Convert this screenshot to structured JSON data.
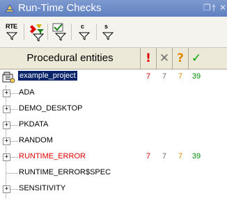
{
  "window": {
    "title": "Run-Time Checks",
    "controls": [
      "❐",
      "†",
      "✕"
    ]
  },
  "toolbar": {
    "rte_label": "RTE",
    "c_label": "c",
    "s_label": "s"
  },
  "table": {
    "header": {
      "entities": "Procedural entities",
      "col1": "!",
      "col2": "✕",
      "col3": "?",
      "col4": "✓"
    },
    "rows": [
      {
        "label": "example_project",
        "c1": "7",
        "c2": "7",
        "c3": "7",
        "c4": "39"
      },
      {
        "label": "ADA"
      },
      {
        "label": "DEMO_DESKTOP"
      },
      {
        "label": "PKDATA"
      },
      {
        "label": "RANDOM"
      },
      {
        "label": "RUNTIME_ERROR",
        "c1": "7",
        "c2": "7",
        "c3": "7",
        "c4": "39"
      },
      {
        "label": "RUNTIME_ERROR$SPEC"
      },
      {
        "label": "SENSITIVITY"
      }
    ]
  },
  "colors": {
    "red": "#e00000",
    "gray": "#6f6f6f",
    "orange": "#e08a00",
    "green": "#008a00",
    "selection": "#0a246a"
  }
}
